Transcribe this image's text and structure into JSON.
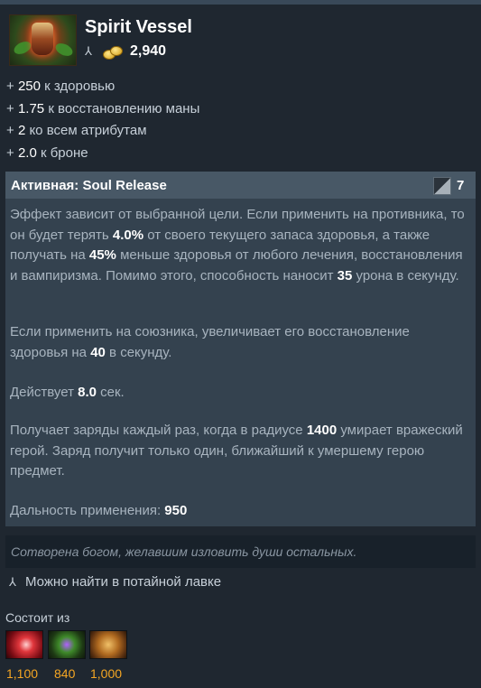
{
  "item": {
    "name": "Spirit Vessel",
    "cost": "2,940",
    "icon": "spirit-vessel-icon"
  },
  "stats": [
    {
      "prefix": "+",
      "value": "250",
      "label": "к здоровью"
    },
    {
      "prefix": "+",
      "value": "1.75",
      "label": "к восстановлению маны"
    },
    {
      "prefix": "+",
      "value": "2",
      "label": "ко всем атрибутам"
    },
    {
      "prefix": "+",
      "value": "2.0",
      "label": "к броне"
    }
  ],
  "ability": {
    "title": "Активная: Soul Release",
    "cooldown": "7",
    "p1": {
      "t1": "Эффект зависит от выбранной цели. Если применить на противника, то он будет терять ",
      "v1": "4.0%",
      "t2": " от своего текущего запаса здоровья, а также получать на ",
      "v2": "45%",
      "t3": " меньше здоровья от любого лечения, восстановления и вампиризма. Помимо этого, способность наносит ",
      "v3": "35",
      "t4": " урона в секунду."
    },
    "p2": {
      "t1": "Если применить на союзника, увеличивает его восстановление здоровья на ",
      "v1": "40",
      "t2": " в секунду."
    },
    "p3": {
      "t1": "Действует ",
      "v1": "8.0",
      "t2": " сек."
    },
    "p4": {
      "t1": "Получает заряды каждый раз, когда в радиусе ",
      "v1": "1400",
      "t2": " умирает вражеский герой. Заряд получит только один, ближайший к умершему герою предмет."
    },
    "p5": {
      "t1": "Дальность применения: ",
      "v1": "950"
    }
  },
  "lore": "Сотворена богом, желавшим изловить души остальных.",
  "shop_note": "Можно найти в потайной лавке",
  "components": {
    "label": "Состоит из",
    "items": [
      {
        "icon": "vitality-booster-icon",
        "cost": "1,100"
      },
      {
        "icon": "urn-of-shadows-icon",
        "cost": "840"
      },
      {
        "icon": "recipe-scroll-icon",
        "cost": "1,000"
      }
    ]
  },
  "colors": {
    "background": "#1f2730",
    "ability_header": "#485866",
    "ability_body": "#34424f",
    "gold": "#f5a623"
  }
}
